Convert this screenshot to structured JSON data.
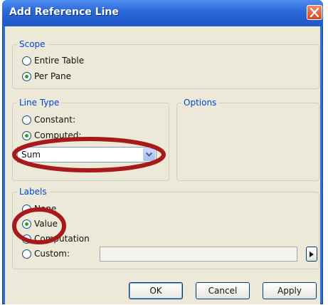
{
  "window": {
    "title": "Add Reference Line"
  },
  "scope": {
    "legend": "Scope",
    "options": [
      {
        "label": "Entire Table",
        "selected": false
      },
      {
        "label": "Per Pane",
        "selected": true
      }
    ]
  },
  "line_type": {
    "legend": "Line Type",
    "constant_label": "Constant:",
    "computed_label": "Computed:",
    "selected": "computed",
    "function_value": "Sum"
  },
  "options_group": {
    "legend": "Options"
  },
  "labels": {
    "legend": "Labels",
    "none_label": "None",
    "value_label": "Value",
    "computation_label": "Computation",
    "custom_label": "Custom:",
    "selected": "value",
    "custom_value": ""
  },
  "footer": {
    "ok_label": "OK",
    "cancel_label": "Cancel",
    "apply_label": "Apply"
  },
  "colors": {
    "accent": "#0046d5",
    "annotation": "#a8191b"
  },
  "icons": {
    "close": "close-icon",
    "dropdown": "chevron-down-icon",
    "insert": "triangle-right-icon"
  }
}
